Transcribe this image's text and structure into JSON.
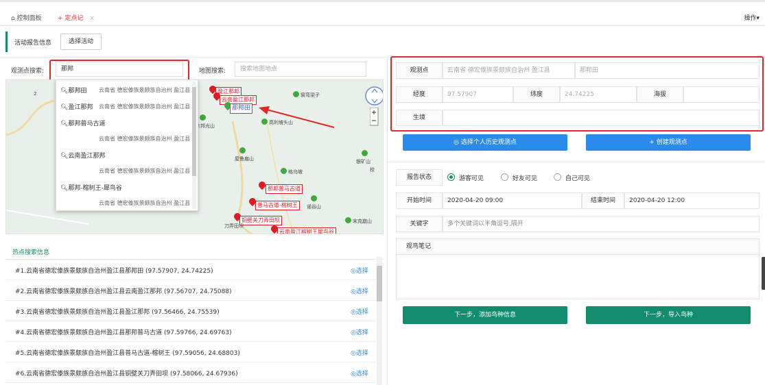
{
  "tabs": {
    "dashboard": "控制面板",
    "current": "定点记",
    "current_prefix": "+",
    "close": "×",
    "ops": "操作▾"
  },
  "activity": {
    "label": "活动报告信息",
    "button": "选择活动"
  },
  "search": {
    "point_label": "观测点搜索:",
    "point_value": "那邦",
    "map_label": "地图搜索:",
    "map_placeholder": "搜索地图地点"
  },
  "dropdown": [
    {
      "name": "那邦田",
      "addr": "云南省 德宏傣族景颇族自治州 盈江县"
    },
    {
      "name": "盈江那邦",
      "addr": "云南省 德宏傣族景颇族自治州 盈江县"
    },
    {
      "name": "那邦普马古道",
      "addr": "云南省 德宏傣族景颇族自治州 盈江县"
    },
    {
      "name": "云南盈江那邦",
      "addr": "云南省 德宏傣族景颇族自治州 盈江县"
    },
    {
      "name": "那邦-榕树王-犀鸟谷",
      "addr": "云南省 德宏傣族景颇族自治州 盈江县"
    }
  ],
  "map": {
    "pins": [
      "盈江那邦",
      "云南盈江那邦",
      "那邦田",
      "那邦普马古道",
      "普马古道-榕树王",
      "铜壁关刀弄田坝",
      "云南盈江榕树王犀鸟谷"
    ],
    "places": [
      "窝弯梁子",
      "东邦光山",
      "高利坡头山",
      "屋鲁扁山",
      "银矿山",
      "格乌坡",
      "诺谷山",
      "宋克崩山",
      "刀弄田坝",
      "校"
    ],
    "scale": "2"
  },
  "hot": {
    "title": "热点搜索信息",
    "select_label": "◎选择",
    "rows": [
      "#1.云南省德宏傣族景颇族自治州盈江县那邦田 (97.57907, 24.74225)",
      "#2.云南省德宏傣族景颇族自治州盈江县云南盈江那邦 (97.56707, 24.75088)",
      "#3.云南省德宏傣族景颇族自治州盈江县盈江那邦 (97.56466, 24.75539)",
      "#4.云南省德宏傣族景颇族自治州盈江县那邦普马古道 (97.59766, 24.69763)",
      "#5.云南省德宏傣族景颇族自治州盈江县普马古道-榕树王 (97.59056, 24.68803)",
      "#6.云南省德宏傣族景颇族自治州盈江县铜壁关刀弄田坝 (97.58066, 24.67936)"
    ]
  },
  "obs": {
    "point_label": "观测点",
    "region": "云南省 德宏傣族景颇族自治州 盈江县",
    "point_name": "那邦田",
    "lng_label": "经度",
    "lng": "97.57907",
    "lat_label": "纬度",
    "lat": "24.74225",
    "alt_label": "海拔",
    "habitat_label": "生境",
    "history_btn": "◎ 选择个人历史观测点",
    "create_btn": "+ 创建观测点"
  },
  "report": {
    "status_label": "报告状态",
    "options": [
      "游客可见",
      "好友可见",
      "自己可见"
    ],
    "start_label": "开始时间",
    "start": "2020-04-20 09:00",
    "end_label": "结束时间",
    "end": "2020-04-20 12:00",
    "keywords_label": "关键字",
    "keywords_placeholder": "多个关键词以半角逗号,隔开",
    "notes_label": "观鸟笔记",
    "next_add": "下一步，添加鸟种信息",
    "next_import": "下一步，导入鸟种"
  },
  "colors": {
    "accent": "#0f8a6b",
    "red": "#e32626",
    "blue": "#2b8bea",
    "link": "#2d8cf0"
  }
}
